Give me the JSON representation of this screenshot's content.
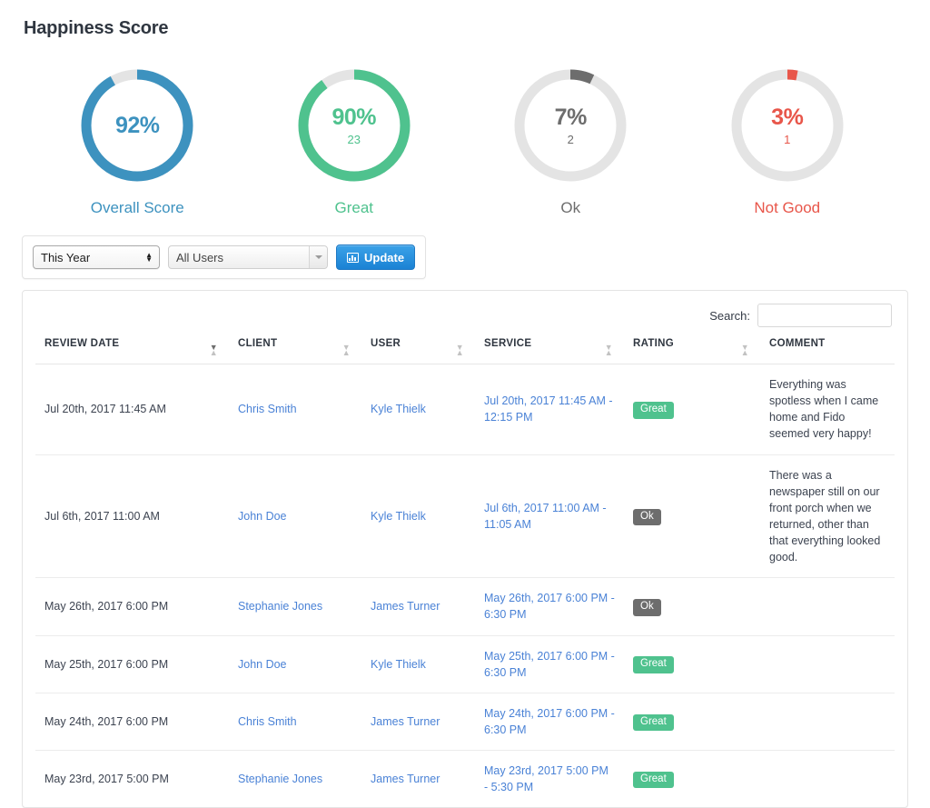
{
  "page": {
    "title": "Happiness Score"
  },
  "chart_data": {
    "type": "pie",
    "title": "Happiness Score",
    "variant": "donut-gauges",
    "track_color": "#e4e4e4",
    "items": [
      {
        "label": "Overall Score",
        "percent": 92,
        "percent_text": "92%",
        "count": null,
        "count_text": "",
        "color": "#3d92bf"
      },
      {
        "label": "Great",
        "percent": 90,
        "percent_text": "90%",
        "count": 23,
        "count_text": "23",
        "color": "#4fc28e"
      },
      {
        "label": "Ok",
        "percent": 7,
        "percent_text": "7%",
        "count": 2,
        "count_text": "2",
        "color": "#6d6d6d"
      },
      {
        "label": "Not Good",
        "percent": 3,
        "percent_text": "3%",
        "count": 1,
        "count_text": "1",
        "color": "#e8564a"
      }
    ]
  },
  "filters": {
    "period": {
      "value": "This Year"
    },
    "users": {
      "value": "All Users"
    },
    "update_button": {
      "label": "Update",
      "icon": "bar-chart-icon"
    }
  },
  "search": {
    "label": "Search:",
    "value": "",
    "placeholder": ""
  },
  "table": {
    "columns": [
      {
        "key": "review_date",
        "label": "Review Date",
        "sortable": true,
        "sorted": "desc"
      },
      {
        "key": "client",
        "label": "Client",
        "sortable": true,
        "sorted": "none"
      },
      {
        "key": "user",
        "label": "User",
        "sortable": true,
        "sorted": "none"
      },
      {
        "key": "service",
        "label": "Service",
        "sortable": true,
        "sorted": "none"
      },
      {
        "key": "rating",
        "label": "Rating",
        "sortable": true,
        "sorted": "none"
      },
      {
        "key": "comment",
        "label": "Comment",
        "sortable": false,
        "sorted": "none"
      }
    ],
    "rows": [
      {
        "review_date": "Jul 20th, 2017 11:45 AM",
        "client": "Chris Smith",
        "user": "Kyle Thielk",
        "service": "Jul 20th, 2017 11:45 AM - 12:15 PM",
        "rating": "Great",
        "rating_type": "great",
        "comment": "Everything was spotless when I came home and Fido seemed very happy!"
      },
      {
        "review_date": "Jul 6th, 2017 11:00 AM",
        "client": "John Doe",
        "user": "Kyle Thielk",
        "service": "Jul 6th, 2017 11:00 AM - 11:05 AM",
        "rating": "Ok",
        "rating_type": "ok",
        "comment": "There was a newspaper still on our front porch when we returned, other than that everything looked good."
      },
      {
        "review_date": "May 26th, 2017 6:00 PM",
        "client": "Stephanie Jones",
        "user": "James Turner",
        "service": "May 26th, 2017 6:00 PM - 6:30 PM",
        "rating": "Ok",
        "rating_type": "ok",
        "comment": ""
      },
      {
        "review_date": "May 25th, 2017 6:00 PM",
        "client": "John Doe",
        "user": "Kyle Thielk",
        "service": "May 25th, 2017 6:00 PM - 6:30 PM",
        "rating": "Great",
        "rating_type": "great",
        "comment": ""
      },
      {
        "review_date": "May 24th, 2017 6:00 PM",
        "client": "Chris Smith",
        "user": "James Turner",
        "service": "May 24th, 2017 6:00 PM - 6:30 PM",
        "rating": "Great",
        "rating_type": "great",
        "comment": ""
      },
      {
        "review_date": "May 23rd, 2017 5:00 PM",
        "client": "Stephanie Jones",
        "user": "James Turner",
        "service": "May 23rd, 2017 5:00 PM - 5:30 PM",
        "rating": "Great",
        "rating_type": "great",
        "comment": ""
      }
    ]
  }
}
